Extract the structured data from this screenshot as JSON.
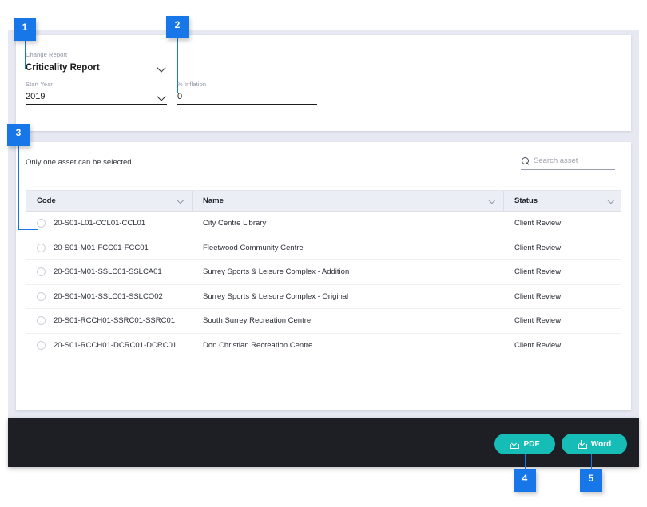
{
  "form": {
    "change_report": {
      "label": "Change Report",
      "value": "Criticality Report"
    },
    "start_year": {
      "label": "Start Year",
      "value": "2019"
    },
    "inflation": {
      "label": "% Inflation",
      "value": "0"
    }
  },
  "asset_panel": {
    "hint": "Only one asset can be selected",
    "search_placeholder": "Search asset",
    "columns": [
      "Code",
      "Name",
      "Status"
    ],
    "rows": [
      {
        "code": "20-S01-L01-CCL01-CCL01",
        "name": "City Centre Library",
        "status": "Client Review"
      },
      {
        "code": "20-S01-M01-FCC01-FCC01",
        "name": "Fleetwood Community Centre",
        "status": "Client Review"
      },
      {
        "code": "20-S01-M01-SSLC01-SSLCA01",
        "name": "Surrey Sports & Leisure Complex - Addition",
        "status": "Client Review"
      },
      {
        "code": "20-S01-M01-SSLC01-SSLCO02",
        "name": "Surrey Sports & Leisure Complex - Original",
        "status": "Client Review"
      },
      {
        "code": "20-S01-RCCH01-SSRC01-SSRC01",
        "name": "South Surrey Recreation Centre",
        "status": "Client Review"
      },
      {
        "code": "20-S01-RCCH01-DCRC01-DCRC01",
        "name": "Don Christian Recreation Centre",
        "status": "Client Review"
      }
    ]
  },
  "footer": {
    "pdf_label": "PDF",
    "word_label": "Word"
  },
  "annotations": {
    "badges": [
      "1",
      "2",
      "3",
      "4",
      "5"
    ]
  },
  "colors": {
    "accent_blue": "#1877e8",
    "button_teal": "#16bdb6",
    "footer_dark": "#1d1f24",
    "canvas": "#e6e9f2"
  }
}
